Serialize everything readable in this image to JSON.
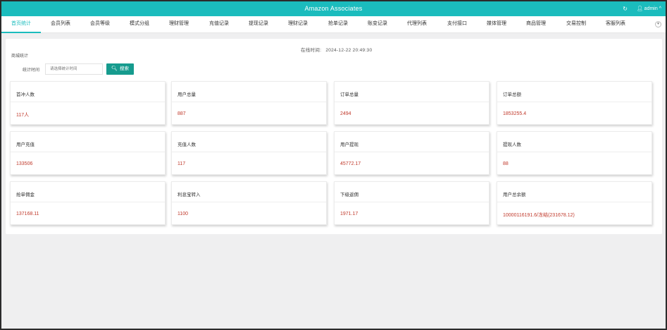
{
  "header": {
    "title": "Amazon Associates",
    "refresh_icon": "refresh-icon",
    "user_label": "admin",
    "user_prefix_icon": "user-icon",
    "user_chevron": "^"
  },
  "tabs": [
    {
      "label": "首页统计",
      "active": true
    },
    {
      "label": "会员列表"
    },
    {
      "label": "会员等级"
    },
    {
      "label": "模式分组"
    },
    {
      "label": "理财管理"
    },
    {
      "label": "充值记录"
    },
    {
      "label": "提现记录"
    },
    {
      "label": "理财记录"
    },
    {
      "label": "抢单记录"
    },
    {
      "label": "账变记录"
    },
    {
      "label": "代理列表"
    },
    {
      "label": "支付接口"
    },
    {
      "label": "媒体管理"
    },
    {
      "label": "商品管理"
    },
    {
      "label": "交易控制"
    },
    {
      "label": "客服列表"
    }
  ],
  "main": {
    "section_title": "商城统计",
    "online_time_label": "在线时间:",
    "online_time_value": "2024-12-22 20:49:30",
    "filter_label": "统计时间",
    "filter_placeholder": "请选择统计时间",
    "search_label": "搜索"
  },
  "cards": [
    {
      "label": "首冲人数",
      "value": "117人"
    },
    {
      "label": "用户总量",
      "value": "887"
    },
    {
      "label": "订单总量",
      "value": "2494"
    },
    {
      "label": "订单总额",
      "value": "1853255.4"
    },
    {
      "label": "用户充值",
      "value": "133506"
    },
    {
      "label": "充值人数",
      "value": "117"
    },
    {
      "label": "用户提现",
      "value": "45772.17"
    },
    {
      "label": "提现人数",
      "value": "88"
    },
    {
      "label": "抢单佣金",
      "value": "137168.11"
    },
    {
      "label": "利息宝转入",
      "value": "1100"
    },
    {
      "label": "下级返佣",
      "value": "1971.17"
    },
    {
      "label": "用户总余额",
      "value": "10000116191.6/冻结(231678.12)"
    }
  ],
  "colors": {
    "accent": "#1bbcbd",
    "button": "#169b8e",
    "value_red": "#c0392b"
  }
}
